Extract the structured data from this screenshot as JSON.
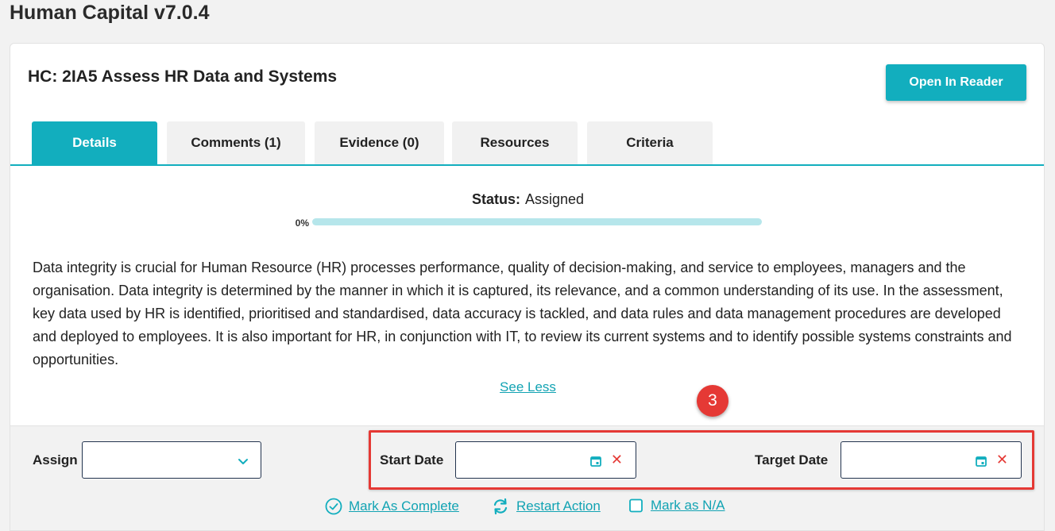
{
  "app": {
    "title": "Human Capital v7.0.4"
  },
  "action": {
    "title": "HC: 2IA5 Assess HR Data and Systems",
    "open_reader_label": "Open In Reader"
  },
  "tabs": [
    {
      "label": "Details",
      "active": true
    },
    {
      "label": "Comments (1)",
      "active": false
    },
    {
      "label": "Evidence (0)",
      "active": false
    },
    {
      "label": "Resources",
      "active": false
    },
    {
      "label": "Criteria",
      "active": false
    }
  ],
  "status": {
    "label": "Status:",
    "value": "Assigned"
  },
  "progress": {
    "label": "0%",
    "percent": 0
  },
  "description": "Data integrity is crucial for Human Resource (HR) processes performance, quality of decision-making, and service to employees, managers and the organisation. Data integrity is determined by the manner in which it is captured, its relevance, and a common understanding of its use. In the assessment, key data used by HR is identified, prioritised and standardised, data accuracy is tackled, and data rules and data management procedures are developed and deployed to employees. It is also important for HR, in conjunction with IT, to review its current systems and to identify possible systems constraints and opportunities.",
  "see_less_label": "See Less",
  "callout": {
    "number": "3",
    "color": "#e53935"
  },
  "form": {
    "assign_label": "Assign",
    "assign_value": "",
    "start_date_label": "Start Date",
    "start_date_value": "",
    "target_date_label": "Target Date",
    "target_date_value": ""
  },
  "links": {
    "mark_complete": "Mark As Complete",
    "restart": "Restart Action",
    "mark_na": "Mark as N/A"
  },
  "colors": {
    "accent": "#12aebe",
    "highlight": "#e53935",
    "input_border": "#23344f"
  }
}
